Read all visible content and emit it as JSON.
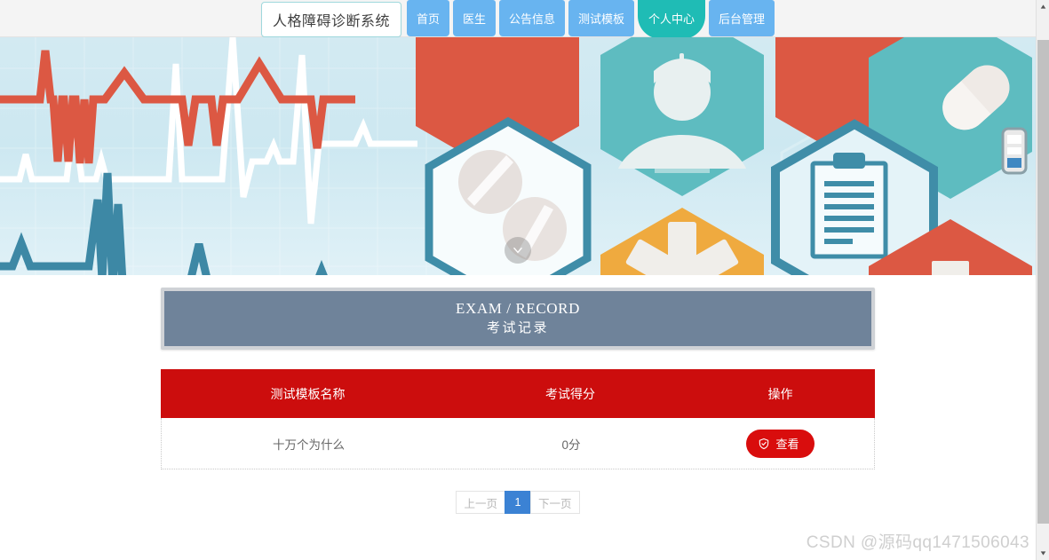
{
  "navbar": {
    "logo": "人格障碍诊断系统",
    "links": [
      {
        "label": "首页",
        "active": false
      },
      {
        "label": "医生",
        "active": false
      },
      {
        "label": "公告信息",
        "active": false
      },
      {
        "label": "测试模板",
        "active": false
      },
      {
        "label": "个人中心",
        "active": true
      },
      {
        "label": "后台管理",
        "active": false
      }
    ]
  },
  "banner": {
    "scroll_down_icon": "chevron-down-icon",
    "colors": {
      "background": "#d5ecf3",
      "ecg_red": "#dc5843",
      "ecg_white": "#ffffff",
      "ecg_blue": "#3d88a5",
      "hex_teal": "#5ebcc0",
      "hex_red": "#dd5b48",
      "hex_orange": "#efaa3f",
      "hex_outline": "#3f8da8"
    }
  },
  "section": {
    "title_en": "EXAM / RECORD",
    "title_cn": "考试记录",
    "panel_color": "#6f839a",
    "frame_color": "#cfd2d6"
  },
  "table": {
    "header_color": "#cc0d0d",
    "columns": [
      "测试模板名称",
      "考试得分",
      "操作"
    ],
    "rows": [
      {
        "name": "十万个为什么",
        "score": "0分",
        "action_label": "查看",
        "action_icon": "shield-check-icon"
      }
    ]
  },
  "pagination": {
    "prev": "上一页",
    "next": "下一页",
    "pages": [
      "1"
    ],
    "current": "1",
    "active_color": "#3b82d4"
  },
  "watermark": "CSDN @源码qq1471506043",
  "scrollbar": {
    "up_icon": "caret-up-icon",
    "down_icon": "caret-down-icon"
  }
}
